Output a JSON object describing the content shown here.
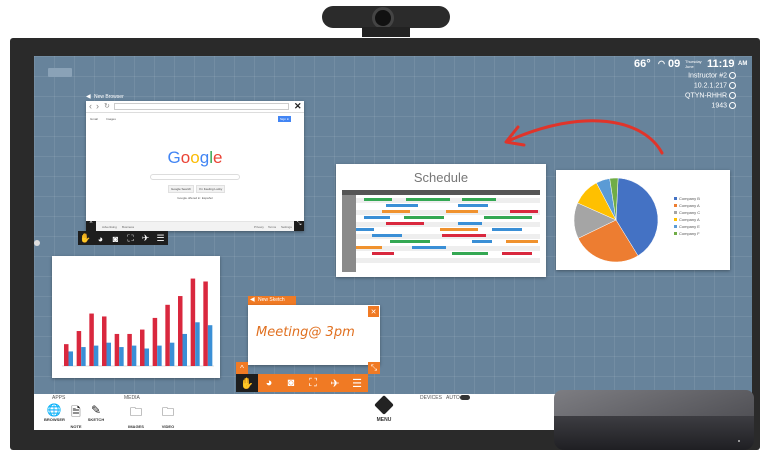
{
  "status": {
    "temperature": "66°",
    "date_day": "09",
    "date_label_top": "Thursday",
    "date_label_bottom": "June",
    "time": "11:19",
    "ampm": "AM",
    "info_lines": [
      "Instructor #2",
      "10.2.1.217",
      "QTYN-RHHR",
      "1943"
    ]
  },
  "browser": {
    "title": "New Browser",
    "logo_letters": [
      "G",
      "o",
      "o",
      "g",
      "l",
      "e"
    ],
    "logo_colors": [
      "#4285f4",
      "#ea4335",
      "#fbbc05",
      "#4285f4",
      "#34a853",
      "#ea4335"
    ],
    "search_button": "Google Search",
    "lucky_button": "I'm Feeling Lucky",
    "footer_text": "Google offered in: Español",
    "header_links": [
      "Gmail",
      "Images"
    ],
    "signin": "Sign in",
    "bottom_left": [
      "Advertising",
      "Business"
    ],
    "bottom_right": [
      "Privacy",
      "Terms",
      "Settings"
    ]
  },
  "schedule": {
    "title": "Schedule"
  },
  "pie": {
    "legend": [
      "Company B",
      "Company A",
      "Company C",
      "Company A",
      "Company E",
      "Company F"
    ],
    "colors": [
      "#4472c4",
      "#ed7d31",
      "#a5a5a5",
      "#ffc000",
      "#5b9bd5",
      "#70ad47"
    ]
  },
  "sketch": {
    "title": "New Sketch",
    "content": "Meeting@ 3pm"
  },
  "toolbar_icons": [
    "hand-icon",
    "palette-icon",
    "camera-icon",
    "fullscreen-icon",
    "pin-icon",
    "list-icon"
  ],
  "dock": {
    "apps_label": "APPS",
    "media_label": "MEDIA",
    "devices_label": "DEVICES",
    "auto_label": "AUTO",
    "apps": [
      {
        "icon": "🌐",
        "name": "BROWSER"
      },
      {
        "icon": "🗎",
        "name": "NOTE"
      },
      {
        "icon": "✎",
        "name": "SKETCH"
      }
    ],
    "media": [
      {
        "icon": "🗀",
        "name": "IMAGES"
      },
      {
        "icon": "🗀",
        "name": "VIDEO"
      }
    ],
    "menu_label": "MENU"
  },
  "chart_data": {
    "type": "bar",
    "categories": [
      "",
      "",
      "",
      "",
      "",
      "",
      "",
      "",
      "",
      "",
      "",
      ""
    ],
    "series": [
      {
        "values": [
          15,
          24,
          36,
          34,
          22,
          22,
          25,
          33,
          42,
          48,
          60,
          58
        ]
      },
      {
        "values": [
          10,
          13,
          14,
          16,
          13,
          14,
          12,
          14,
          16,
          22,
          30,
          28
        ]
      }
    ],
    "ylim": [
      0,
      70
    ],
    "colors": [
      "#d9283e",
      "#3a8fd6"
    ]
  }
}
